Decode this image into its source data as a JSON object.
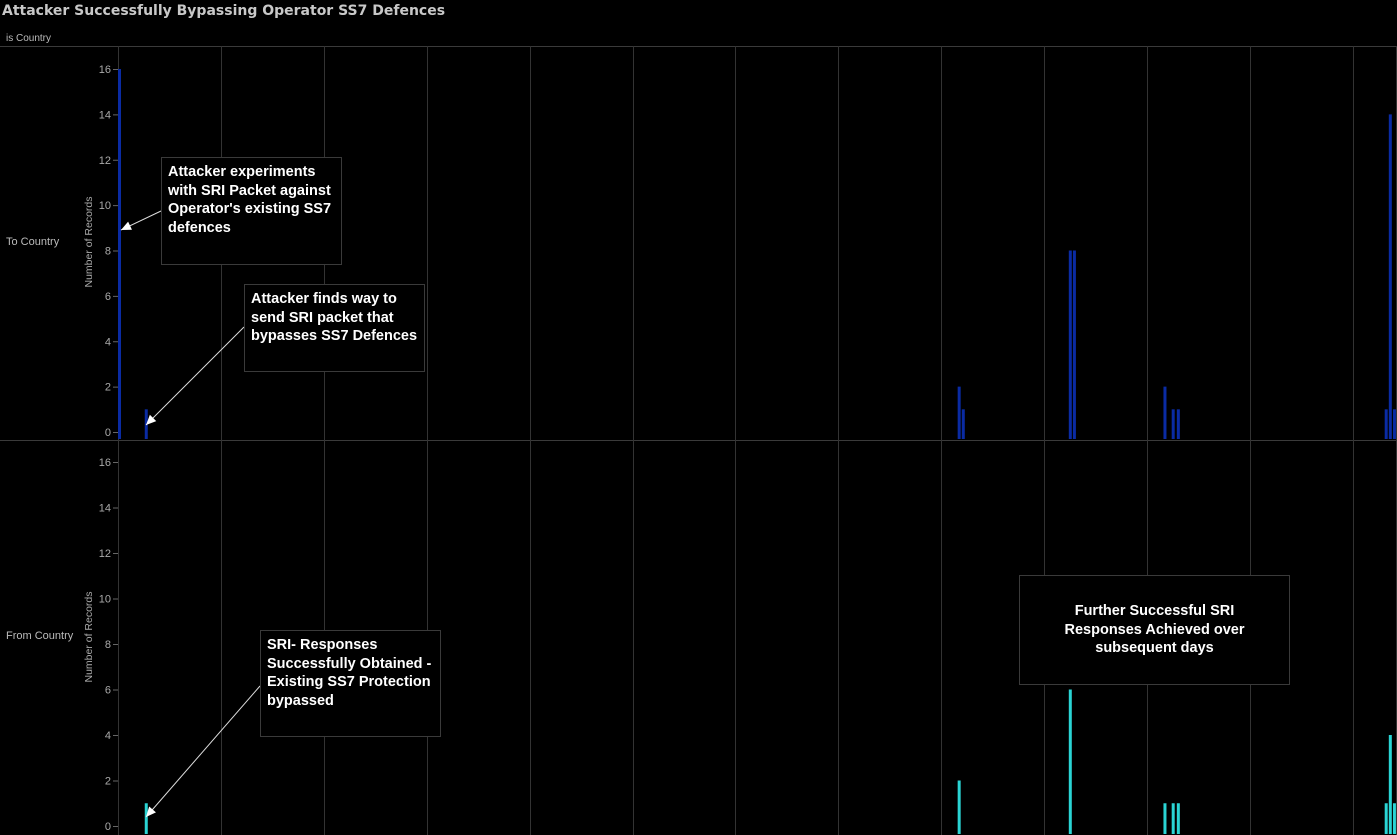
{
  "chart_data": {
    "type": "bar",
    "title": "Attacker Successfully Bypassing Operator SS7 Defences",
    "column_header": "is Country",
    "ylabel": "Number of Records",
    "ylim": [
      0,
      16
    ],
    "yticks": [
      "0",
      "2",
      "4",
      "6",
      "8",
      "10",
      "12",
      "14",
      "16"
    ],
    "grid": true,
    "x_grid_count": 13,
    "panels": [
      {
        "name": "To Country",
        "color": "#0a2ba3",
        "bars": [
          {
            "x": 0.0,
            "value": 16
          },
          {
            "x": 0.26,
            "value": 1
          },
          {
            "x": 8.16,
            "value": 2
          },
          {
            "x": 8.2,
            "value": 1
          },
          {
            "x": 9.24,
            "value": 8
          },
          {
            "x": 9.28,
            "value": 8
          },
          {
            "x": 10.16,
            "value": 2
          },
          {
            "x": 10.24,
            "value": 1
          },
          {
            "x": 10.29,
            "value": 1
          },
          {
            "x": 12.31,
            "value": 1
          },
          {
            "x": 12.35,
            "value": 14
          },
          {
            "x": 12.39,
            "value": 1
          }
        ]
      },
      {
        "name": "From Country",
        "color": "#2ad4d4",
        "bars": [
          {
            "x": 0.26,
            "value": 1
          },
          {
            "x": 8.16,
            "value": 2
          },
          {
            "x": 9.24,
            "value": 6
          },
          {
            "x": 10.16,
            "value": 1
          },
          {
            "x": 10.24,
            "value": 1
          },
          {
            "x": 10.29,
            "value": 1
          },
          {
            "x": 12.31,
            "value": 1
          },
          {
            "x": 12.35,
            "value": 4
          },
          {
            "x": 12.39,
            "value": 1
          }
        ]
      }
    ],
    "annotations": [
      {
        "panel": "To Country",
        "text": "Attacker experiments with SRI Packet against Operator's existing SS7 defences",
        "points_to": {
          "x": 0.0,
          "value": 9
        }
      },
      {
        "panel": "To Country",
        "text": "Attacker finds way to send SRI packet that bypasses SS7 Defences",
        "points_to": {
          "x": 0.26,
          "value": 0.7
        }
      },
      {
        "panel": "From Country",
        "text": "SRI- Responses Successfully Obtained - Existing SS7 Protection bypassed",
        "points_to": {
          "x": 0.26,
          "value": 0.7
        }
      },
      {
        "panel": "From Country",
        "text": "Further Successful SRI Responses Achieved over subsequent days",
        "points_to": null
      }
    ]
  }
}
